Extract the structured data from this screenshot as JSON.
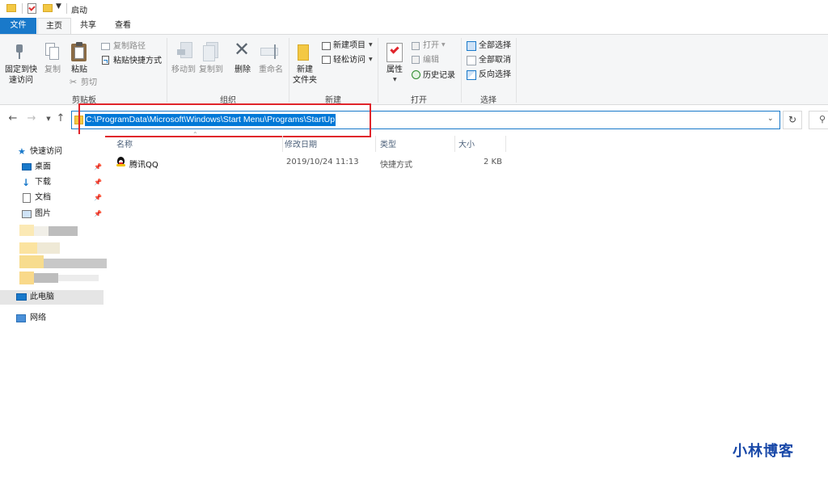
{
  "titlebar": {
    "title": "启动"
  },
  "tabs": {
    "file": "文件",
    "home": "主页",
    "share": "共享",
    "view": "查看"
  },
  "ribbon": {
    "clipboard": {
      "pin_quick_access": "固定到快\n速访问",
      "copy": "复制",
      "paste": "粘贴",
      "copy_path": "复制路径",
      "paste_shortcut": "粘贴快捷方式",
      "cut": "剪切",
      "group_label": "剪贴板"
    },
    "organize": {
      "move_to": "移动到",
      "copy_to": "复制到",
      "delete": "删除",
      "rename": "重命名",
      "group_label": "组织"
    },
    "new": {
      "new_folder": "新建\n文件夹",
      "new_item": "新建项目",
      "easy_access": "轻松访问",
      "group_label": "新建"
    },
    "open": {
      "properties": "属性",
      "open": "打开",
      "edit": "编辑",
      "history": "历史记录",
      "group_label": "打开"
    },
    "select": {
      "select_all": "全部选择",
      "select_none": "全部取消",
      "invert": "反向选择",
      "group_label": "选择"
    }
  },
  "address": {
    "path": "C:\\ProgramData\\Microsoft\\Windows\\Start Menu\\Programs\\StartUp"
  },
  "nav": {
    "quick_access": "快速访问",
    "desktop": "桌面",
    "downloads": "下载",
    "documents": "文档",
    "pictures": "图片",
    "this_pc": "此电脑",
    "network": "网络"
  },
  "columns": {
    "name": "名称",
    "modified": "修改日期",
    "type": "类型",
    "size": "大小"
  },
  "files": [
    {
      "name": "腾讯QQ",
      "modified": "2019/10/24 11:13",
      "type": "快捷方式",
      "size": "2 KB"
    }
  ],
  "watermark": "小林博客",
  "colors": {
    "accent": "#1979ca",
    "selection": "#0078d7",
    "highlight_box": "#e0242b",
    "watermark": "#1848a8"
  }
}
